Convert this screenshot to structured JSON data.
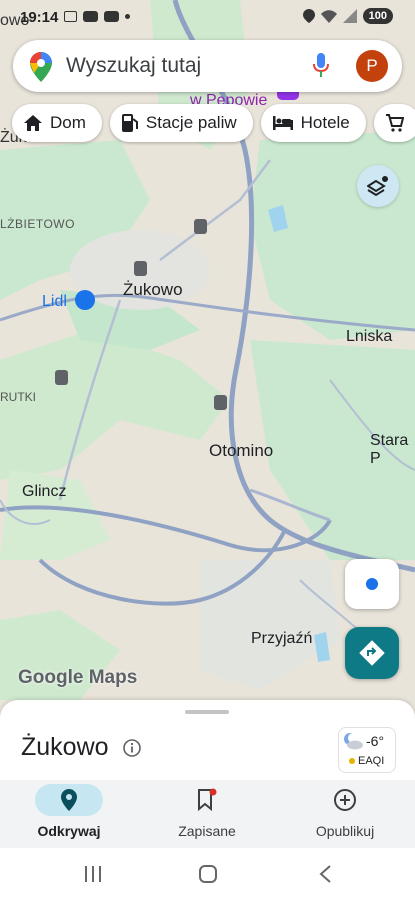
{
  "status_bar": {
    "time": "19:14",
    "battery": "100"
  },
  "search": {
    "placeholder": "Wyszukaj tutaj",
    "avatar_letter": "P"
  },
  "chips": [
    {
      "label": "Dom",
      "icon": "home-icon"
    },
    {
      "label": "Stacje paliw",
      "icon": "gas-station-icon"
    },
    {
      "label": "Hotele",
      "icon": "hotel-bed-icon"
    }
  ],
  "map_labels": {
    "zukowo": "Żukowo",
    "lidl": "Lidl",
    "lniska": "Lniska",
    "otomino": "Otomino",
    "glincz": "Glincz",
    "stara": "Stara P",
    "przyjazn": "Przyjaźń",
    "elzbietowo": "LŻBIETOWO",
    "rutki": "RUTKI",
    "zukowo_edge": "Żuko",
    "pepowie": "w Pępowie",
    "owo": "owo"
  },
  "logo": "Google Maps",
  "place": {
    "title": "Żukowo"
  },
  "weather": {
    "temp": "-6°",
    "aqi_label": "EAQI"
  },
  "nav": [
    {
      "label": "Odkrywaj",
      "icon": "explore-pin-icon",
      "active": true
    },
    {
      "label": "Zapisane",
      "icon": "bookmark-icon",
      "active": false
    },
    {
      "label": "Opublikuj",
      "icon": "add-circle-icon",
      "active": false
    }
  ],
  "colors": {
    "accent": "#0e7a86",
    "map_bg": "#e9e4da",
    "green": "#c9e8cf",
    "water": "#9fd3ee",
    "road": "#8fa2c4"
  }
}
